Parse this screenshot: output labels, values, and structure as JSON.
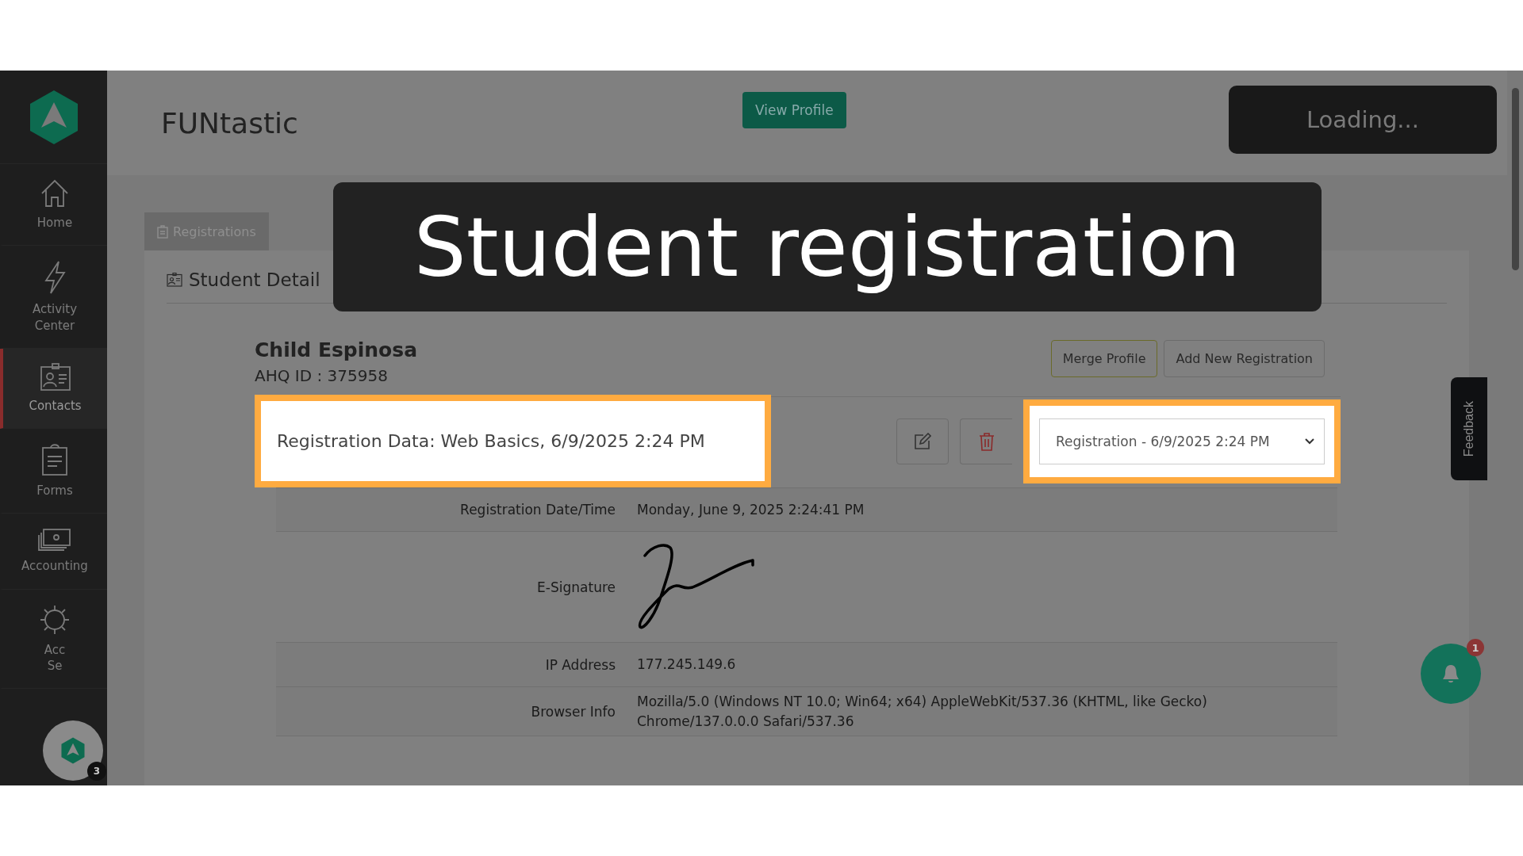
{
  "sidebar": {
    "items": [
      {
        "lines": [
          "Home"
        ],
        "selected": false
      },
      {
        "lines": [
          "Activity",
          "Center"
        ],
        "selected": false
      },
      {
        "lines": [
          "Contacts"
        ],
        "selected": true
      },
      {
        "lines": [
          "Forms"
        ],
        "selected": false
      },
      {
        "lines": [
          "Accounting"
        ],
        "selected": false
      },
      {
        "lines": [
          "Acc",
          "Se"
        ],
        "selected": false
      }
    ]
  },
  "header": {
    "title": "FUNtastic",
    "button": "View Profile",
    "status": "Loading..."
  },
  "tabs": [
    {
      "label": "Registrations",
      "selected": true
    }
  ],
  "section_title": "Student Detail",
  "student": {
    "name": "Child Espinosa",
    "id_line": "AHQ ID : 375958"
  },
  "actions": [
    {
      "kind": "merge",
      "label": "Merge Profile"
    },
    {
      "kind": "add",
      "label": "Add New Registration"
    }
  ],
  "registration": {
    "heading": "Registration Data: Web Basics, 6/9/2025 2:24 PM",
    "highlighted": true,
    "dropdown": {
      "value": "Registration - 6/9/2025 2:24 PM",
      "highlighted": true
    }
  },
  "details": [
    {
      "kind": "text",
      "label": "Registration Date/Time",
      "value": "Monday, June 9, 2025 2:24:41 PM"
    },
    {
      "kind": "signature",
      "label": "E-Signature"
    },
    {
      "kind": "text",
      "label": "IP Address",
      "value": "177.245.149.6"
    },
    {
      "kind": "text",
      "label": "Browser Info",
      "value": "Mozilla/5.0 (Windows NT 10.0; Win64; x64) AppleWebKit/537.36 (KHTML, like Gecko) Chrome/137.0.0.0 Safari/537.36"
    }
  ],
  "feedback": "Feedback",
  "notifications": {
    "count": "1"
  },
  "chat_launcher": {
    "count": "3"
  },
  "caption": "Student registration"
}
